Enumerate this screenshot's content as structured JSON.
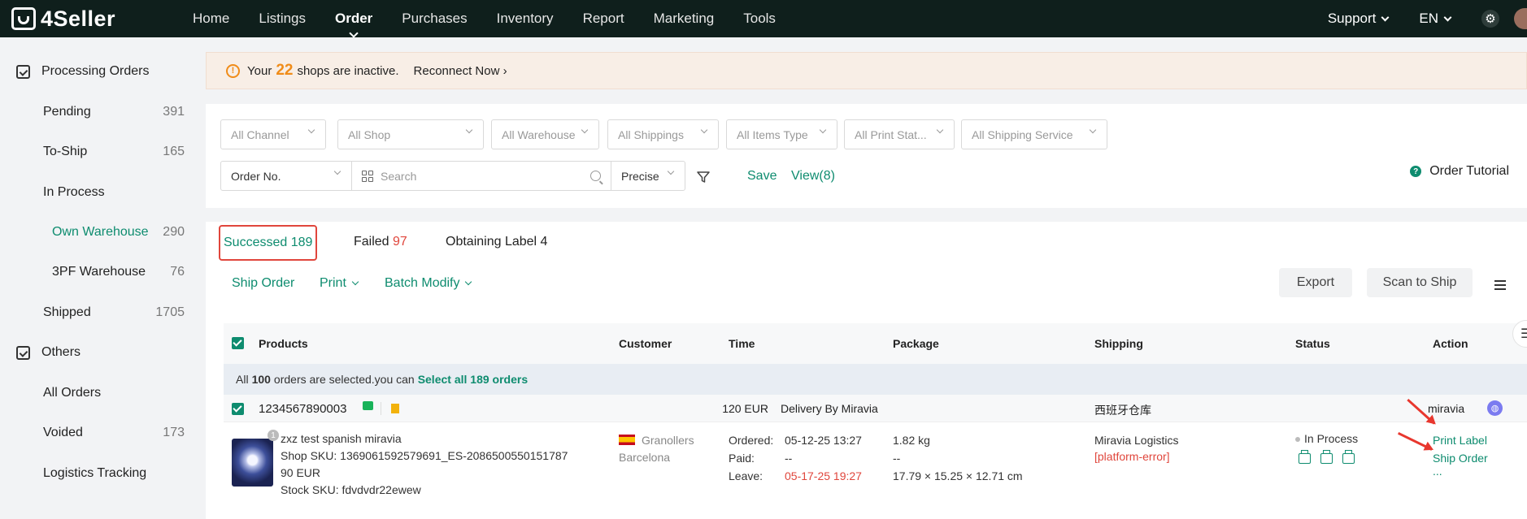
{
  "app": {
    "logo_text": "4Seller"
  },
  "nav": {
    "items": [
      "Home",
      "Listings",
      "Order",
      "Purchases",
      "Inventory",
      "Report",
      "Marketing",
      "Tools"
    ],
    "active": "Order",
    "support": "Support",
    "language": "EN"
  },
  "sidebar": {
    "group1": "Processing Orders",
    "items": [
      {
        "label": "Pending",
        "count": "391"
      },
      {
        "label": "To-Ship",
        "count": "165"
      },
      {
        "label": "In Process",
        "count": ""
      },
      {
        "label": "Own Warehouse",
        "count": "290"
      },
      {
        "label": "3PF Warehouse",
        "count": "76"
      },
      {
        "label": "Shipped",
        "count": "1705"
      }
    ],
    "group2": "Others",
    "others": [
      {
        "label": "All Orders",
        "count": ""
      },
      {
        "label": "Voided",
        "count": "173"
      },
      {
        "label": "Logistics Tracking",
        "count": ""
      }
    ]
  },
  "banner": {
    "prefix": "Your",
    "count": "22",
    "suffix": "shops are inactive.",
    "link": "Reconnect Now"
  },
  "filters": {
    "selects": [
      "All Channel",
      "All Shop",
      "All Warehouse",
      "All Shippings",
      "All Items Type",
      "All Print Stat...",
      "All Shipping Service"
    ],
    "search_field": "Order No.",
    "search_placeholder": "Search",
    "match_mode": "Precise",
    "save": "Save",
    "view": "View(8)",
    "tutorial": "Order Tutorial"
  },
  "tabs": {
    "successed_label": "Successed",
    "successed_count": "189",
    "failed_label": "Failed",
    "failed_count": "97",
    "obtaining_label": "Obtaining Label",
    "obtaining_count": "4"
  },
  "actions": {
    "ship_order": "Ship Order",
    "print": "Print",
    "batch_modify": "Batch Modify",
    "export": "Export",
    "scan_to_ship": "Scan to Ship"
  },
  "table": {
    "headers": [
      "Products",
      "Customer",
      "Time",
      "Package",
      "Shipping",
      "Status",
      "Action"
    ],
    "selection": {
      "prefix": "All",
      "count": "100",
      "middle": "orders are selected.you can",
      "link": "Select all 189 orders"
    },
    "order": {
      "order_no": "1234567890003",
      "amount": "120 EUR",
      "delivery": "Delivery By Miravia",
      "warehouse": "西班牙仓库",
      "platform": "miravia",
      "product_name": "zxz test spanish miravia",
      "quantity": "1",
      "shop_sku": "Shop SKU: 1369061592579691_ES-2086500550151787",
      "price": "90 EUR",
      "stock_sku": "Stock SKU: fdvdvdr22ewew",
      "city": "Granollers",
      "province": "Barcelona",
      "ordered_label": "Ordered:",
      "ordered": "05-12-25 13:27",
      "paid_label": "Paid:",
      "paid": "--",
      "leave_label": "Leave:",
      "leave": "05-17-25 19:27",
      "weight": "1.82 kg",
      "package_extra": "--",
      "dimensions": "17.79 × 15.25 × 12.71 cm",
      "carrier": "Miravia Logistics",
      "carrier_error": "[platform-error]",
      "status": "In Process",
      "print_label": "Print Label",
      "ship_order": "Ship Order",
      "more": "..."
    }
  },
  "colors": {
    "accent": "#0e8c6f",
    "topbar": "#0f1f1c",
    "warning": "#f08c19",
    "error": "#e0463c"
  }
}
